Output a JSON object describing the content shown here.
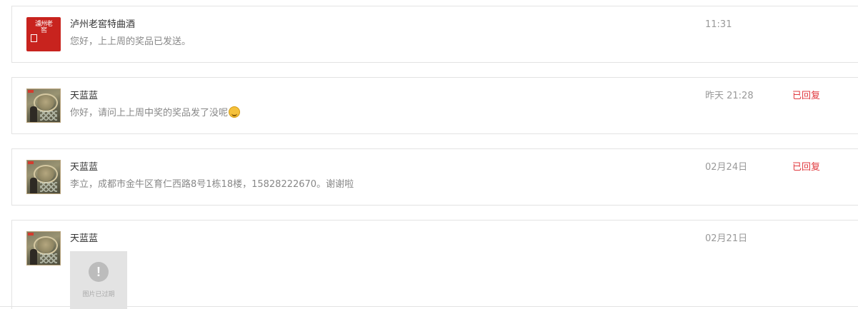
{
  "conversations": [
    {
      "avatar": "brand-logo",
      "avatar_text": "瀘州老窖",
      "name": "泸州老窖特曲酒",
      "message": "您好，上上周的奖品已发送。",
      "time": "11:31",
      "status": ""
    },
    {
      "avatar": "user-photo",
      "name": "天蓝蓝",
      "message": "你好，请问上上周中奖的奖品发了没呢",
      "emoji": "laughing-face-emoji",
      "time": "昨天 21:28",
      "status": "已回复"
    },
    {
      "avatar": "user-photo",
      "name": "天蓝蓝",
      "message": "李立，成都市金牛区育仁西路8号1栋18楼，15828222670。谢谢啦",
      "time": "02月24日",
      "status": "已回复"
    },
    {
      "avatar": "user-photo",
      "name": "天蓝蓝",
      "image_placeholder": {
        "icon": "exclamation-icon",
        "label": "图片已过期"
      },
      "time": "02月21日",
      "status": ""
    }
  ],
  "colors": {
    "status_replied": "#e0393e",
    "brand_red": "#c8231e",
    "muted_text": "#888888"
  }
}
